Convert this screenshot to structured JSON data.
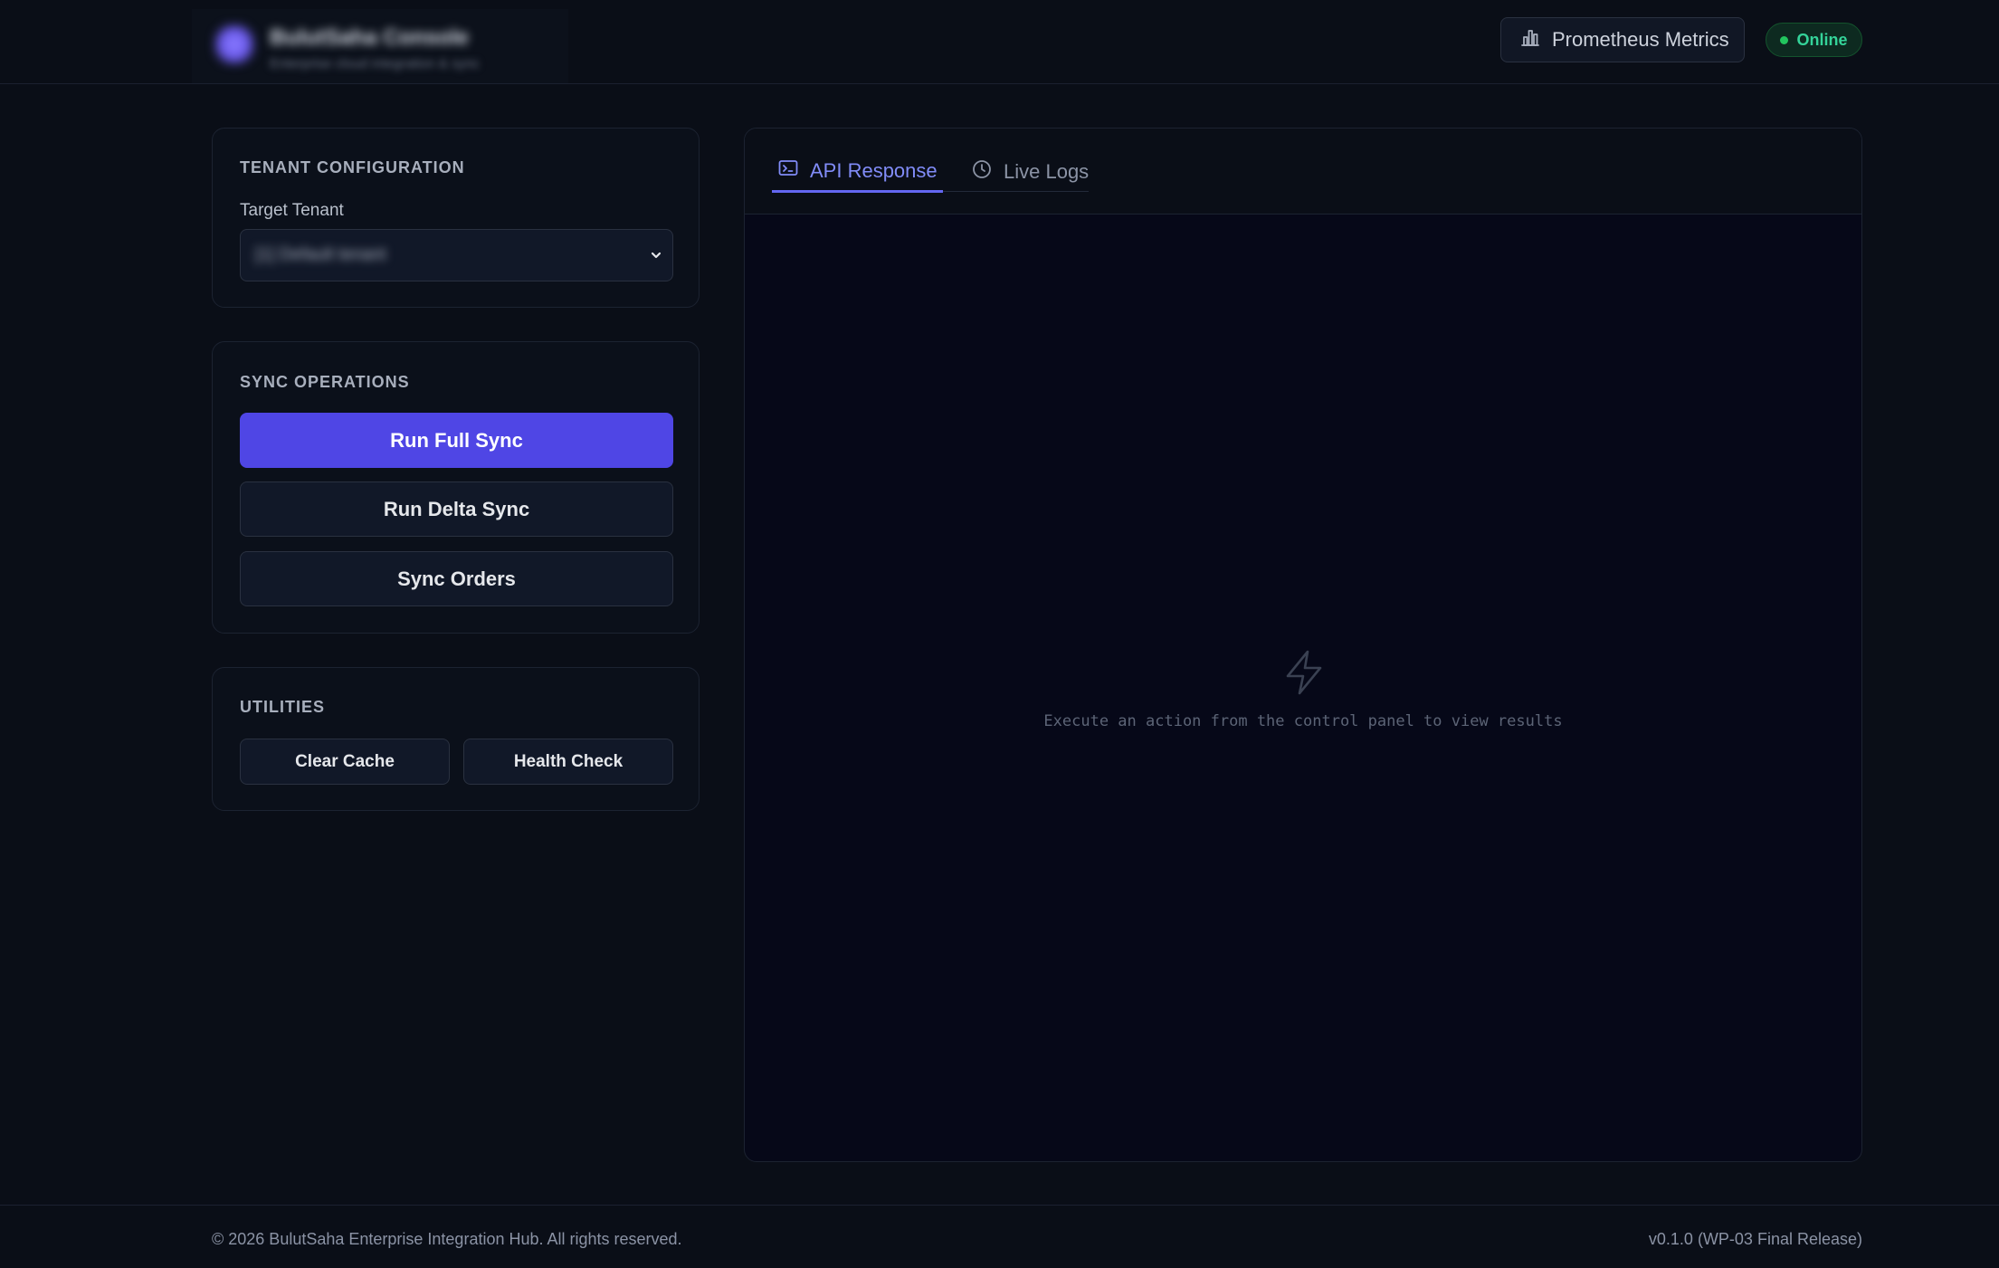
{
  "header": {
    "brand_title": "BulutSaha Console",
    "brand_subtitle": "Enterprise cloud integration & sync",
    "metrics_label": "Prometheus Metrics",
    "metrics_icon": "bar-chart-icon",
    "status_label": "Online",
    "status_color": "#22c55e"
  },
  "tenant": {
    "title": "TENANT CONFIGURATION",
    "target_label": "Target Tenant",
    "selected_value": "[1] Default tenant"
  },
  "sync": {
    "title": "SYNC OPERATIONS",
    "full_sync_label": "Run Full Sync",
    "delta_sync_label": "Run Delta Sync",
    "orders_label": "Sync Orders"
  },
  "utilities": {
    "title": "UTILITIES",
    "clear_cache_label": "Clear Cache",
    "health_check_label": "Health Check"
  },
  "panel": {
    "tabs": [
      {
        "label": "API Response",
        "icon": "terminal-icon",
        "active": true
      },
      {
        "label": "Live Logs",
        "icon": "clock-icon",
        "active": false
      }
    ],
    "empty_icon": "lightning-icon",
    "empty_message": "Execute an action from the control panel to view results"
  },
  "footer": {
    "copyright": "© 2026 BulutSaha Enterprise Integration Hub. All rights reserved.",
    "version": "v0.1.0 (WP-03 Final Release)"
  },
  "colors": {
    "accent": "#4f46e5",
    "accent_text": "#818cf8",
    "background": "#0a0e17"
  }
}
